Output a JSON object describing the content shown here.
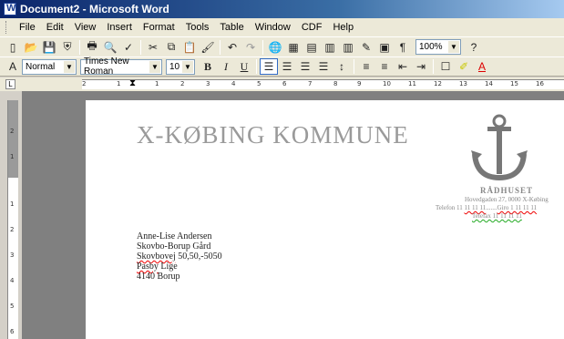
{
  "window": {
    "title": "Document2 - Microsoft Word"
  },
  "menu": [
    "File",
    "Edit",
    "View",
    "Insert",
    "Format",
    "Tools",
    "Table",
    "Window",
    "CDF",
    "Help"
  ],
  "toolbar": {
    "zoom": "100%"
  },
  "format_bar": {
    "style": "Normal",
    "font": "Times New Roman",
    "size": "10",
    "bold": "B",
    "italic": "I",
    "underline": "U"
  },
  "ruler": {
    "h_ticks": [
      "2",
      "1",
      "1",
      "2",
      "3",
      "4",
      "5",
      "6",
      "7",
      "8",
      "9",
      "10",
      "11",
      "12",
      "13",
      "14",
      "15",
      "16"
    ],
    "v_ticks": [
      "2",
      "1",
      "1",
      "2",
      "3",
      "4",
      "5",
      "6"
    ]
  },
  "document": {
    "heading": "X-KØBING KOMMUNE",
    "radhuset": {
      "title": "RÅDHUSET",
      "address": "Hovedgaden 27, 0000 X-Købing",
      "phone_prefix": "Telefon 11 ",
      "phone_spelled": "11 11 11",
      "phone_dots": ".......",
      "giro": "Giro 1 11 11 11",
      "fax": "Telefax 11 11 11 11"
    },
    "recipient": {
      "name": "Anne-Lise Andersen",
      "line2": "Skovbo-Borup Gård",
      "street_spelled": "Skovbovej",
      "street_rest": " 50,50,-5050",
      "town_spelled": "Pasby",
      "town_rest": " Lige",
      "postal": "4140 Borup"
    }
  },
  "colors": {
    "title_bar": "#0a246a",
    "heading": "#9a9a9a",
    "workspace": "#808080"
  }
}
